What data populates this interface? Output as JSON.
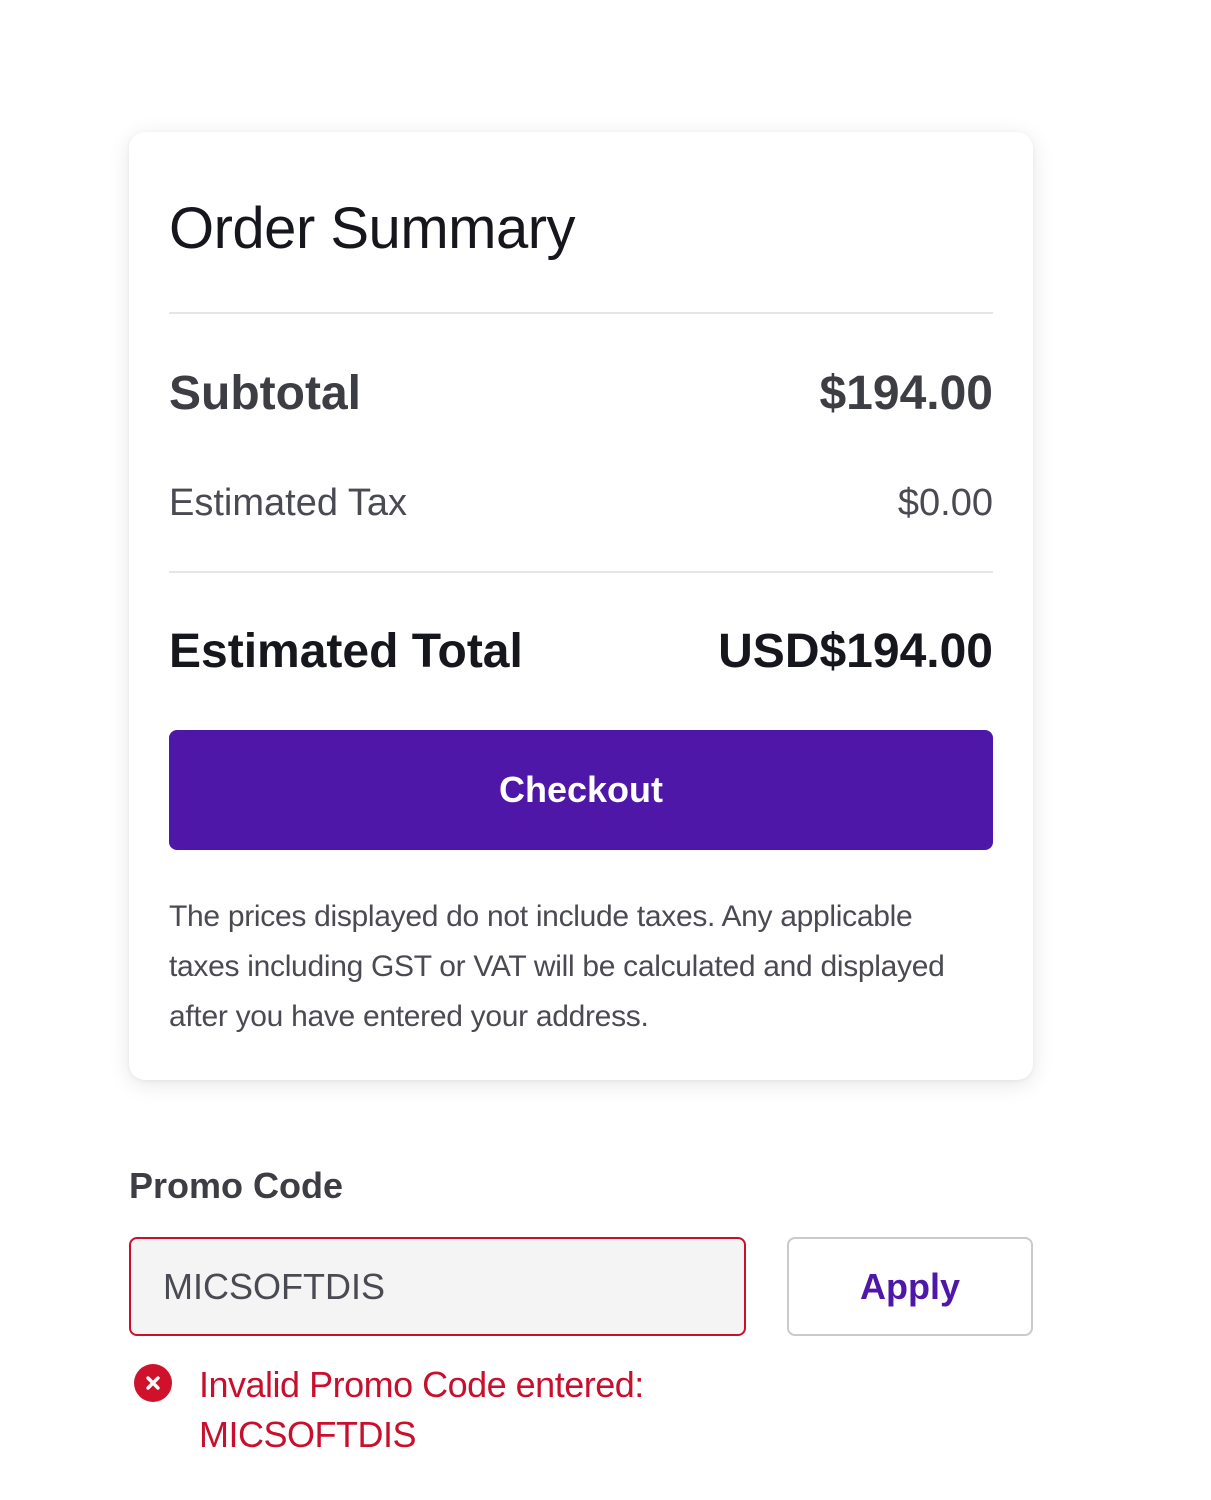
{
  "order_summary": {
    "title": "Order Summary",
    "subtotal_label": "Subtotal",
    "subtotal_value": "$194.00",
    "tax_label": "Estimated Tax",
    "tax_value": "$0.00",
    "total_label": "Estimated Total",
    "total_value": "USD$194.00",
    "checkout_label": "Checkout",
    "disclaimer": "The prices displayed do not include taxes. Any applicable taxes including GST or VAT will be calculated and displayed after you have entered your address."
  },
  "promo": {
    "label": "Promo Code",
    "input_value": "MICSOFTDIS",
    "apply_label": "Apply",
    "error_message": "Invalid Promo Code entered: MICSOFTDIS",
    "error_icon": "close-circle-icon"
  },
  "colors": {
    "accent": "#4f17a8",
    "error": "#c8102e",
    "text_dark": "#16161d",
    "text_muted": "#4a4a52"
  }
}
